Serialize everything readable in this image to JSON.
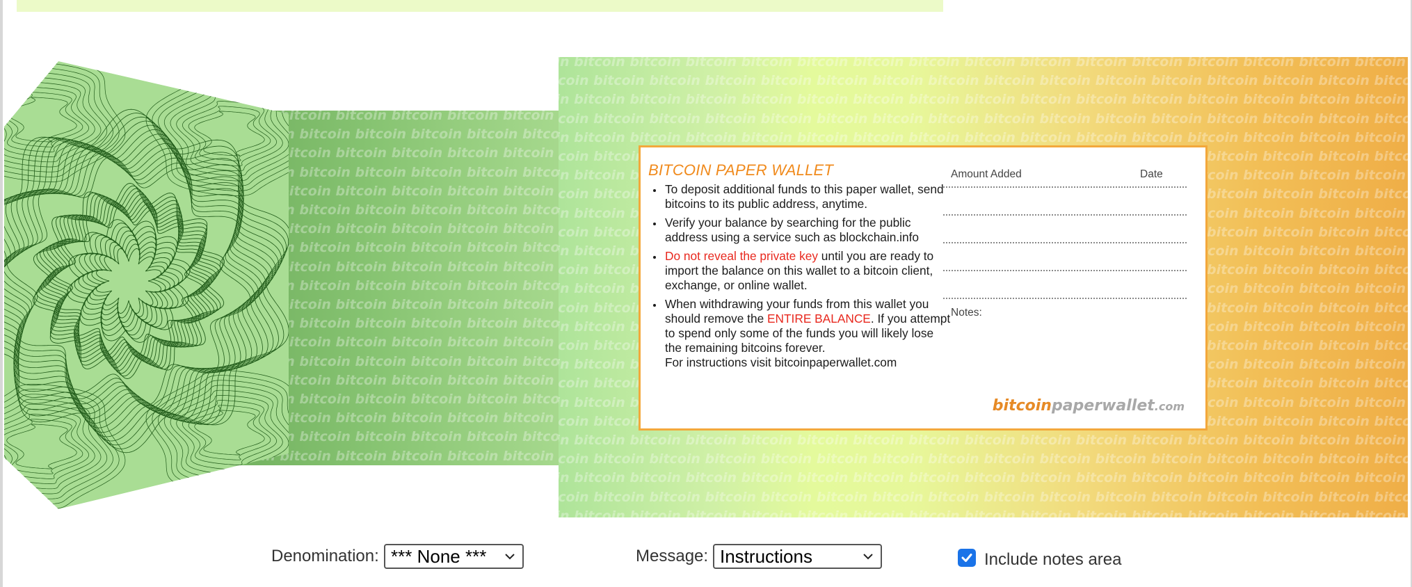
{
  "design": {
    "watermark_word": "bitcoin",
    "colors": {
      "panel_green": "#aee49a",
      "panel_yellow": "#e7f79a",
      "panel_orange": "#efae47",
      "card_border": "#f3a83c",
      "title_orange": "#f08a1c",
      "warning_red": "#e8281e"
    }
  },
  "card": {
    "title": "BITCOIN PAPER WALLET",
    "bullet1": "To deposit additional funds to this paper wallet, send bitcoins to its public address, anytime.",
    "bullet2": "Verify your balance by searching for the public address using a service such as blockchain.info",
    "bullet3_warning": "Do not reveal the private key",
    "bullet3_rest": " until you are ready to import the balance on this wallet to a bitcoin client, exchange, or online wallet.",
    "bullet4_a": "When withdrawing your funds from this wallet you should remove the ",
    "bullet4_warning": "ENTIRE BALANCE",
    "bullet4_b": ". If you attempt to spend only some of the funds you will likely lose the remaining bitcoins forever.",
    "bullet4_c": "For instructions visit bitcoinpaperwallet.com",
    "ledger_amount_label": "Amount Added",
    "ledger_date_label": "Date",
    "notes_label": "Notes:",
    "brand_part1": "bitcoin",
    "brand_part2": "paperwallet",
    "brand_part3": ".com"
  },
  "controls": {
    "denomination_label": "Denomination:",
    "denomination_value": "*** None ***",
    "message_label": "Message:",
    "message_value": "Instructions",
    "notes_checkbox_label": "Include notes area",
    "notes_checkbox_checked": true
  }
}
